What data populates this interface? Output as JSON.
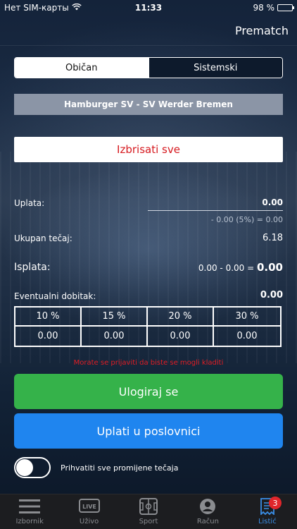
{
  "status_bar": {
    "carrier": "Нет SIM-карты",
    "time": "11:33",
    "battery": "98 %",
    "battery_level": 0.98
  },
  "header": {
    "title": "Prematch"
  },
  "segment": {
    "options": [
      "Običan",
      "Sistemski"
    ],
    "selected": "Običan"
  },
  "match": {
    "title": "Hamburger SV - SV Werder Bremen"
  },
  "clear_button": "Izbrisati sve",
  "stake": {
    "label": "Uplata:",
    "value": "0.00",
    "note": "- 0.00 (5%) = 0.00"
  },
  "total_odds": {
    "label": "Ukupan tečaj:",
    "value": "6.18"
  },
  "payout": {
    "label": "Isplata:",
    "formula": "0.00 - 0.00 =",
    "value": "0.00"
  },
  "potential_win": {
    "label": "Eventualni dobitak:",
    "value": "0.00"
  },
  "bonus_table": {
    "headers": [
      "10 %",
      "15 %",
      "20 %",
      "30 %"
    ],
    "values": [
      "0.00",
      "0.00",
      "0.00",
      "0.00"
    ]
  },
  "warning": "Morate se prijaviti da biste se mogli kladiti",
  "login_button": "Ulogiraj se",
  "pay_button": "Uplati u poslovnici",
  "accept_changes": {
    "label": "Prihvatiti sve promijene tečaja",
    "enabled": false
  },
  "tabs": [
    {
      "label": "Izbornik",
      "icon": "menu-icon"
    },
    {
      "label": "Uživo",
      "icon": "live-icon"
    },
    {
      "label": "Sport",
      "icon": "sport-field-icon"
    },
    {
      "label": "Račun",
      "icon": "account-icon"
    },
    {
      "label": "Listić",
      "icon": "ticket-icon",
      "badge": "3",
      "active": true
    }
  ],
  "colors": {
    "accent_blue": "#1f85ef",
    "login_green": "#35b24a",
    "warning_red": "#e21d24",
    "tab_active": "#3a8ee6"
  }
}
